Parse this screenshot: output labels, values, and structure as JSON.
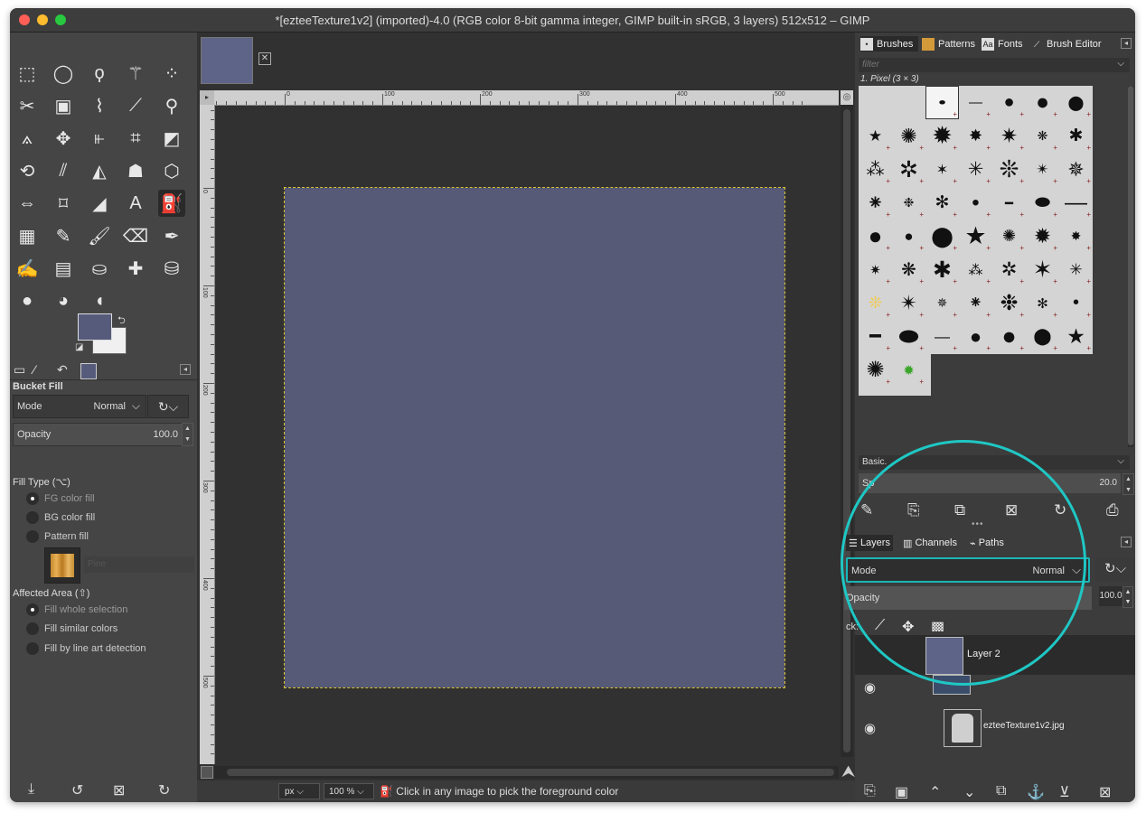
{
  "window": {
    "title": "*[ezteeTexture1v2] (imported)-4.0 (RGB color 8-bit gamma integer, GIMP built-in sRGB, 3 layers) 512x512 – GIMP"
  },
  "toolbox": {
    "tools": [
      "rect-select",
      "ellipse-select",
      "free-select",
      "fuzzy-select",
      "select-by-color",
      "scissors-select",
      "foreground-select",
      "paths",
      "color-picker",
      "zoom",
      "measure",
      "move",
      "align",
      "crop",
      "unified-transform",
      "rotate",
      "shear",
      "perspective",
      "warp-transform",
      "3d-transform",
      "flip",
      "cage-transform",
      "handle-transform",
      "text",
      "bucket-fill",
      "gradient",
      "pencil",
      "paintbrush",
      "eraser",
      "airbrush",
      "ink",
      "mypaint-brush",
      "clone",
      "heal",
      "perspective-clone",
      "smudge",
      "blur-sharpen",
      "dodge-burn"
    ],
    "active_tool": "bucket-fill",
    "fg_color": "#565b7c",
    "bg_color": "#f0f0f0"
  },
  "tool_options": {
    "title": "Bucket Fill",
    "mode_label": "Mode",
    "mode_value": "Normal",
    "opacity_label": "Opacity",
    "opacity_value": "100.0",
    "fill_type_label": "Fill Type  (⌥)",
    "fill_types": [
      "FG color fill",
      "BG color fill",
      "Pattern fill"
    ],
    "pattern_name": "Pine",
    "affected_area_label": "Affected Area  (⇧)",
    "affected_areas": [
      "Fill whole selection",
      "Fill similar colors",
      "Fill by line art detection"
    ]
  },
  "canvas": {
    "ruler_marks": [
      "0",
      "100",
      "200",
      "300",
      "400",
      "500"
    ],
    "image_color": "#565a77"
  },
  "status": {
    "unit": "px",
    "zoom": "100 %",
    "message": "Click in any image to pick the foreground color"
  },
  "brushes": {
    "tabs": [
      "Brushes",
      "Patterns",
      "Fonts",
      "Brush Editor"
    ],
    "filter_placeholder": "filter",
    "selected_name": "1. Pixel (3 × 3)",
    "tag": "Basic.",
    "spacing_label": "Sp",
    "spacing_value": "20.0"
  },
  "layers": {
    "tabs": [
      "Layers",
      "Channels",
      "Paths"
    ],
    "mode_label": "Mode",
    "mode_value": "Normal",
    "opacity_label": "Opacity",
    "opacity_value": "100.0",
    "lock_label": "ck:",
    "items": [
      {
        "name": "Layer 2",
        "thumb_color": "#5e6388"
      },
      {
        "name": "",
        "thumb_color": "#3b4d6a"
      },
      {
        "name": "ezteeTexture1v2.jpg",
        "thumb_color": "#cfcfcf"
      }
    ]
  }
}
